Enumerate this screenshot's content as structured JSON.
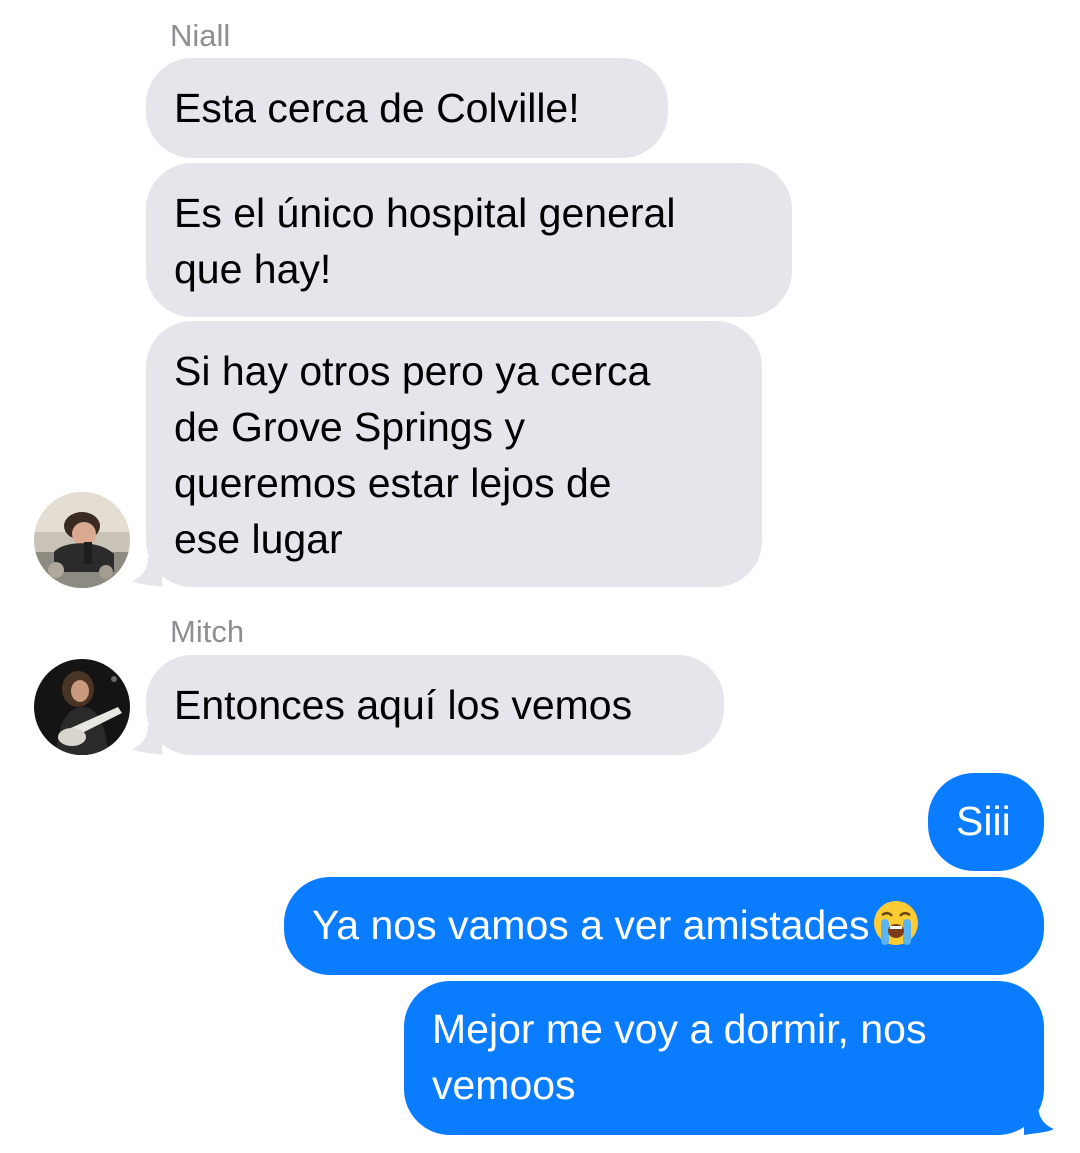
{
  "messages": [
    {
      "sender": "Niall"
    },
    {
      "text": "Esta cerca de Colville!"
    },
    {
      "lines": [
        "Es el único hospital general",
        "que hay!"
      ]
    },
    {
      "lines": [
        "Si hay otros pero ya cerca",
        "de Grove Springs y",
        "queremos estar lejos de",
        "ese lugar"
      ]
    },
    {
      "sender": "Mitch"
    },
    {
      "text": "Entonces aquí los vemos"
    },
    {
      "text": "Siii"
    },
    {
      "text": "Ya nos vamos a ver amistades",
      "emoji": "loudly-crying-face-icon"
    },
    {
      "lines": [
        "Mejor me voy a dormir, nos",
        "vemoos"
      ]
    }
  ],
  "colors": {
    "incoming_bubble": "#e6e5eb",
    "outgoing_bubble": "#0a7cff",
    "sender_label": "#8e8e93"
  }
}
